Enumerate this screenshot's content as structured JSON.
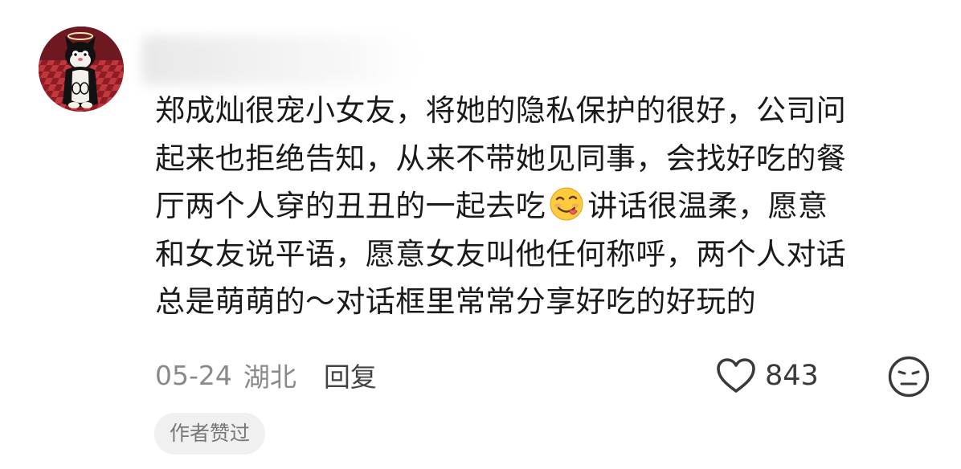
{
  "comment": {
    "author_name": "",
    "lines": [
      "郑成灿很宠小女友，将她的隐私保护的很好，公司问",
      "起来也拒绝告知，从来不带她见同事，会找好吃的餐",
      "厅两个人穿的丑丑的一起去吃",
      "讲话很温柔，愿意",
      "和女友说平语，愿意女友叫他任何称呼，两个人对话",
      "总是萌萌的～对话框里常常分享好吃的好玩的"
    ],
    "emoji": "yum-face-icon"
  },
  "meta": {
    "date": "05-24",
    "location": "湖北",
    "reply_label": "回复"
  },
  "actions": {
    "like_count": "843",
    "like_icon": "heart-outline-icon",
    "dislike_icon": "meh-face-icon"
  },
  "badge": {
    "label": "作者赞过"
  },
  "colors": {
    "text_primary": "#1a1a1a",
    "text_secondary": "#8a8a8a",
    "badge_bg": "#f0f0f0",
    "avatar_bg": "#8c1e26"
  }
}
